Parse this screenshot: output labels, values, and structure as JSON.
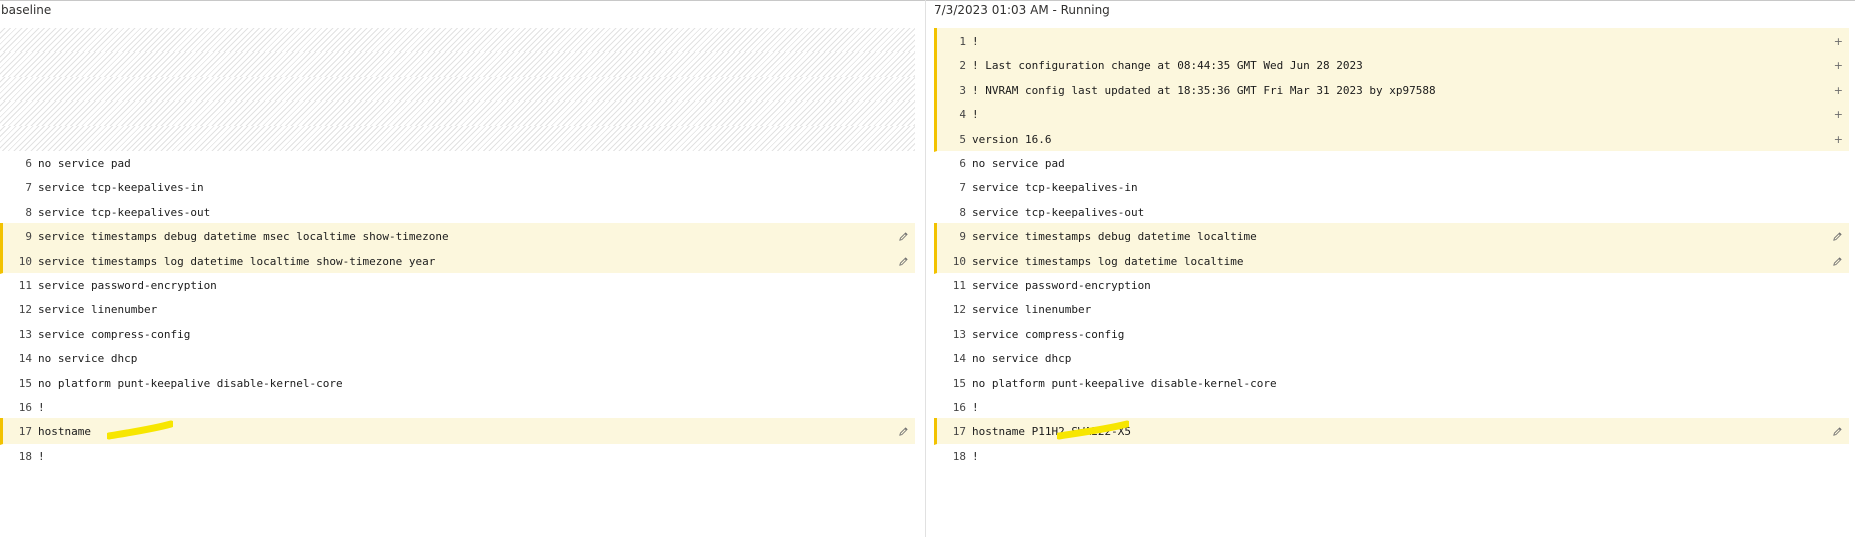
{
  "left_pane": {
    "title": "baseline",
    "rows": [
      {
        "kind": "hatch"
      },
      {
        "kind": "hatch"
      },
      {
        "kind": "hatch"
      },
      {
        "kind": "hatch"
      },
      {
        "kind": "hatch"
      },
      {
        "kind": "plain",
        "num": "6",
        "text": "no service pad"
      },
      {
        "kind": "plain",
        "num": "7",
        "text": "service tcp-keepalives-in"
      },
      {
        "kind": "plain",
        "num": "8",
        "text": "service tcp-keepalives-out"
      },
      {
        "kind": "mod",
        "num": "9",
        "text": "service timestamps debug datetime msec localtime show-timezone",
        "icon": "pencil-icon"
      },
      {
        "kind": "mod",
        "num": "10",
        "text": "service timestamps log datetime localtime show-timezone year",
        "icon": "pencil-icon"
      },
      {
        "kind": "plain",
        "num": "11",
        "text": "service password-encryption"
      },
      {
        "kind": "plain",
        "num": "12",
        "text": "service linenumber"
      },
      {
        "kind": "plain",
        "num": "13",
        "text": "service compress-config"
      },
      {
        "kind": "plain",
        "num": "14",
        "text": "no service dhcp"
      },
      {
        "kind": "plain",
        "num": "15",
        "text": "no platform punt-keepalive disable-kernel-core"
      },
      {
        "kind": "plain",
        "num": "16",
        "text": "!"
      },
      {
        "kind": "mod",
        "num": "17",
        "text": "hostname",
        "icon": "pencil-icon",
        "redaction": true
      },
      {
        "kind": "plain",
        "num": "18",
        "text": "!"
      }
    ]
  },
  "right_pane": {
    "title": "7/3/2023 01:03 AM - Running",
    "rows": [
      {
        "kind": "add",
        "num": "1",
        "text": "!",
        "action": "+"
      },
      {
        "kind": "add",
        "num": "2",
        "text": "! Last configuration change at 08:44:35 GMT Wed Jun 28 2023",
        "action": "+"
      },
      {
        "kind": "add",
        "num": "3",
        "text": "! NVRAM config last updated at 18:35:36 GMT Fri Mar 31 2023 by xp97588",
        "action": "+"
      },
      {
        "kind": "add",
        "num": "4",
        "text": "!",
        "action": "+"
      },
      {
        "kind": "add",
        "num": "5",
        "text": "version 16.6",
        "action": "+"
      },
      {
        "kind": "plain",
        "num": "6",
        "text": "no service pad"
      },
      {
        "kind": "plain",
        "num": "7",
        "text": "service tcp-keepalives-in"
      },
      {
        "kind": "plain",
        "num": "8",
        "text": "service tcp-keepalives-out"
      },
      {
        "kind": "mod",
        "num": "9",
        "text": "service timestamps debug datetime localtime",
        "icon": "pencil-icon"
      },
      {
        "kind": "mod",
        "num": "10",
        "text": "service timestamps log datetime localtime",
        "icon": "pencil-icon"
      },
      {
        "kind": "plain",
        "num": "11",
        "text": "service password-encryption"
      },
      {
        "kind": "plain",
        "num": "12",
        "text": "service linenumber"
      },
      {
        "kind": "plain",
        "num": "13",
        "text": "service compress-config"
      },
      {
        "kind": "plain",
        "num": "14",
        "text": "no service dhcp"
      },
      {
        "kind": "plain",
        "num": "15",
        "text": "no platform punt-keepalive disable-kernel-core"
      },
      {
        "kind": "plain",
        "num": "16",
        "text": "!"
      },
      {
        "kind": "mod",
        "num": "17",
        "text": "hostname P11H2-SWA222-X5",
        "icon": "pencil-icon",
        "redaction": true
      },
      {
        "kind": "plain",
        "num": "18",
        "text": "!"
      }
    ]
  },
  "colors": {
    "changed_bg": "#fcf7dd",
    "changed_bar": "#f2c200",
    "redaction": "#f7e600"
  }
}
